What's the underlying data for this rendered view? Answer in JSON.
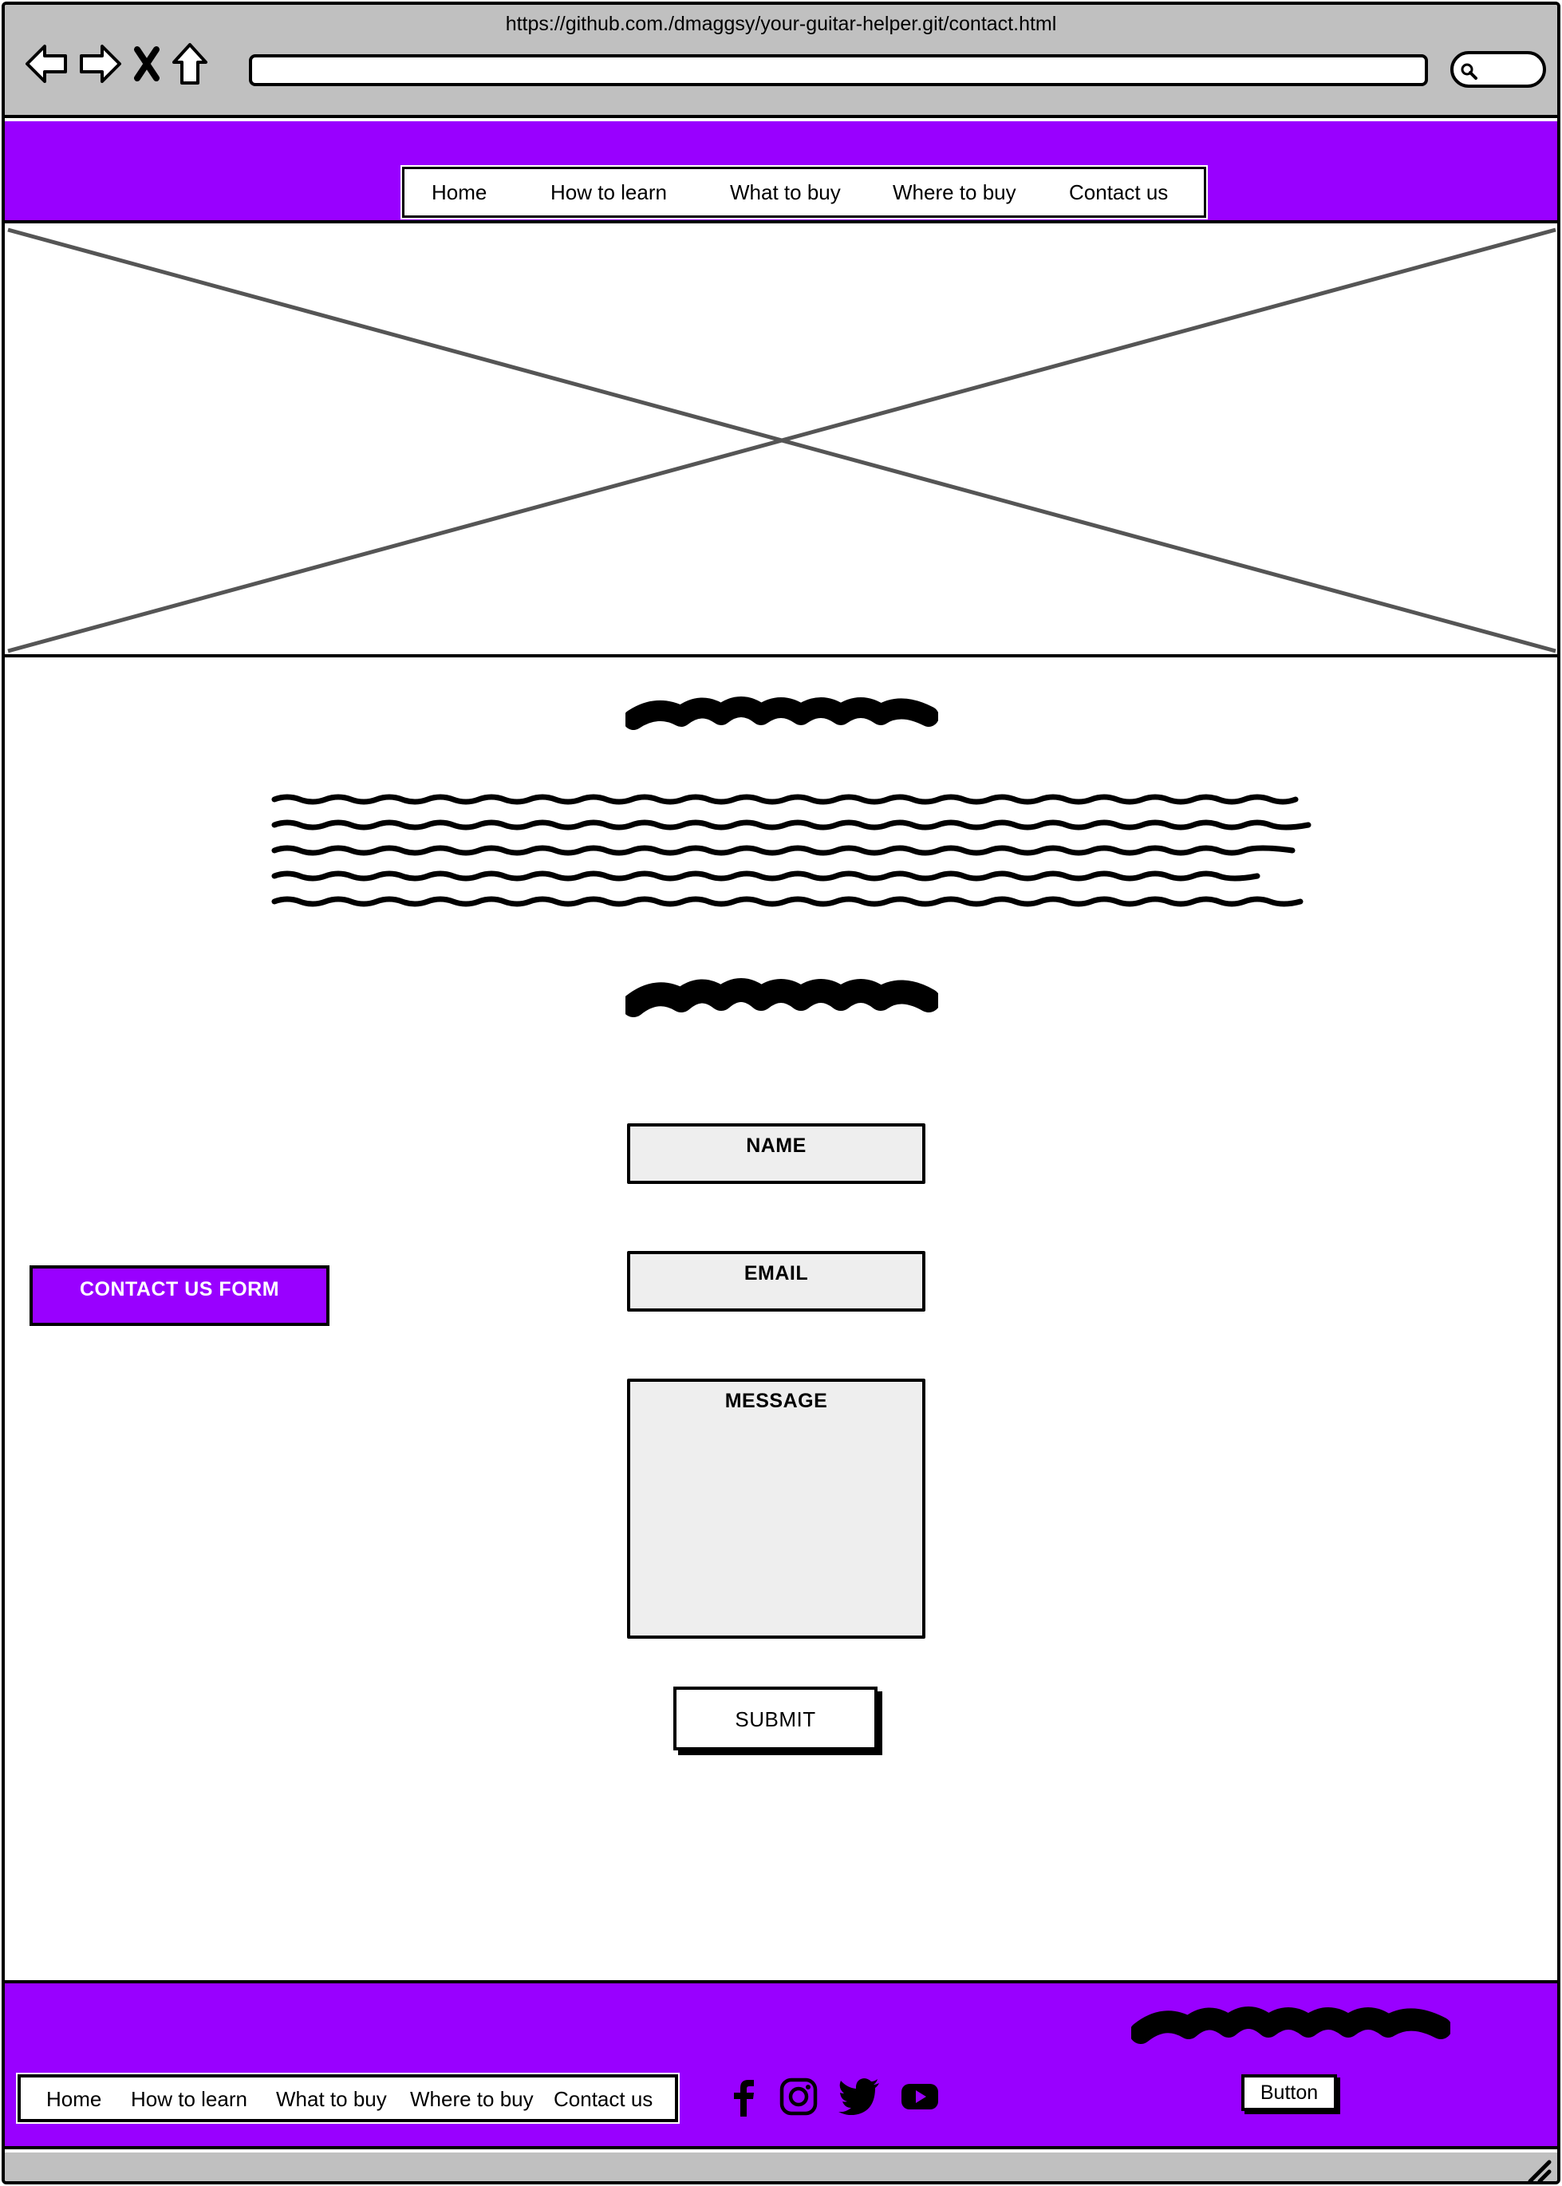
{
  "browser": {
    "url": "https://github.com./dmaggsy/your-guitar-helper.git/contact.html"
  },
  "header_nav": {
    "items": [
      "Home",
      "How to learn",
      "What to buy",
      "Where to buy",
      "Contact us"
    ]
  },
  "form": {
    "side_button_label": "CONTACT US FORM",
    "name_label": "NAME",
    "email_label": "EMAIL",
    "message_label": "MESSAGE",
    "submit_label": "SUBMIT"
  },
  "footer": {
    "nav_items": [
      "Home",
      "How to learn",
      "What to buy",
      "Where to buy",
      "Contact us"
    ],
    "socials": [
      "facebook-icon",
      "instagram-icon",
      "twitter-icon",
      "youtube-icon"
    ],
    "button_label": "Button"
  },
  "colors": {
    "accent": "#9900ff",
    "chrome": "#c0c0c0",
    "field": "#eeeeee"
  }
}
